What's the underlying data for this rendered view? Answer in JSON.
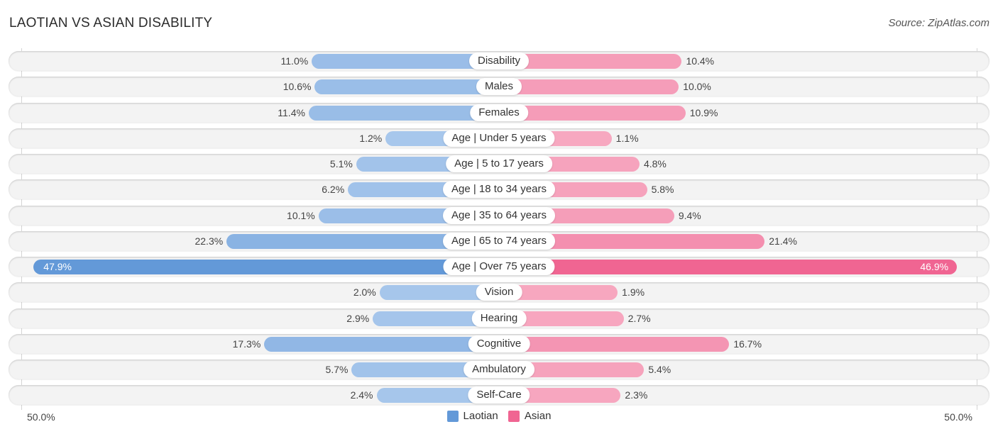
{
  "chart_data": {
    "type": "bar",
    "orientation": "horizontal-diverging",
    "title": "LAOTIAN VS ASIAN DISABILITY",
    "source": "Source: ZipAtlas.com",
    "categories": [
      "Disability",
      "Males",
      "Females",
      "Age | Under 5 years",
      "Age | 5 to 17 years",
      "Age | 18 to 34 years",
      "Age | 35 to 64 years",
      "Age | 65 to 74 years",
      "Age | Over 75 years",
      "Vision",
      "Hearing",
      "Cognitive",
      "Ambulatory",
      "Self-Care"
    ],
    "series": [
      {
        "name": "Laotian",
        "color": "#6399d8",
        "light_color": "#a9c8ec",
        "values": [
          11.0,
          10.6,
          11.4,
          1.2,
          5.1,
          6.2,
          10.1,
          22.3,
          47.9,
          2.0,
          2.9,
          17.3,
          5.7,
          2.4
        ],
        "labels": [
          "11.0%",
          "10.6%",
          "11.4%",
          "1.2%",
          "5.1%",
          "6.2%",
          "10.1%",
          "22.3%",
          "47.9%",
          "2.0%",
          "2.9%",
          "17.3%",
          "5.7%",
          "2.4%"
        ]
      },
      {
        "name": "Asian",
        "color": "#f06592",
        "light_color": "#f7a9c1",
        "values": [
          10.4,
          10.0,
          10.9,
          1.1,
          4.8,
          5.8,
          9.4,
          21.4,
          46.9,
          1.9,
          2.7,
          16.7,
          5.4,
          2.3
        ],
        "labels": [
          "10.4%",
          "10.0%",
          "10.9%",
          "1.1%",
          "4.8%",
          "5.8%",
          "9.4%",
          "21.4%",
          "46.9%",
          "1.9%",
          "2.7%",
          "16.7%",
          "5.4%",
          "2.3%"
        ]
      }
    ],
    "highlighted_category": "Age | Over 75 years",
    "xlim": [
      -50,
      50
    ],
    "axis_labels": {
      "left": "50.0%",
      "right": "50.0%"
    },
    "legend": {
      "position": "bottom-center",
      "entries": [
        "Laotian",
        "Asian"
      ]
    },
    "grid": false
  }
}
